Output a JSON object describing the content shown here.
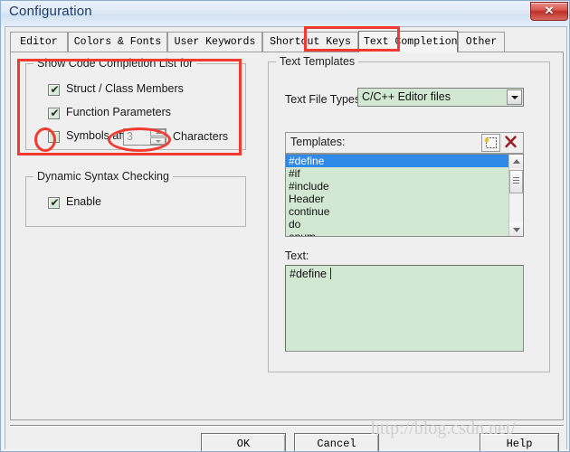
{
  "window": {
    "title": "Configuration",
    "close_label": "✕"
  },
  "tabs": [
    {
      "label": "Editor",
      "active": false
    },
    {
      "label": "Colors & Fonts",
      "active": false
    },
    {
      "label": "User Keywords",
      "active": false
    },
    {
      "label": "Shortcut Keys",
      "active": false
    },
    {
      "label": "Text Completion",
      "active": true
    },
    {
      "label": "Other",
      "active": false
    }
  ],
  "left_panel": {
    "completion_group": {
      "legend": "Show Code Completion List for",
      "checkboxes": [
        {
          "label": "Struct / Class Members",
          "checked": true
        },
        {
          "label": "Function Parameters",
          "checked": true
        },
        {
          "label": "Symbols after",
          "checked": false
        }
      ],
      "spinner_value": "3",
      "characters_label": "Characters",
      "check_glyph": "✔"
    },
    "syntax_group": {
      "legend": "Dynamic Syntax Checking",
      "checkbox": {
        "label": "Enable",
        "checked": true
      }
    }
  },
  "right_panel": {
    "legend": "Text Templates",
    "file_types_label": "Text File Types:",
    "file_types_value": "C/C++ Editor files",
    "templates_label": "Templates:",
    "templates": [
      {
        "name": "#define",
        "selected": true
      },
      {
        "name": "#if",
        "selected": false
      },
      {
        "name": "#include",
        "selected": false
      },
      {
        "name": "Header",
        "selected": false
      },
      {
        "name": "continue",
        "selected": false
      },
      {
        "name": "do",
        "selected": false
      },
      {
        "name": "enum",
        "selected": false
      }
    ],
    "text_label": "Text:",
    "text_value": "#define "
  },
  "buttons": {
    "ok": "OK",
    "cancel": "Cancel",
    "help": "Help"
  },
  "watermark": "http://blog.csdn.net/",
  "colors": {
    "accent_selection": "#2e8ae6",
    "field_green": "#d2e8d2",
    "annotation_red": "#f23b30",
    "dialog_gray": "#efefef",
    "title_text": "#1f3864"
  }
}
